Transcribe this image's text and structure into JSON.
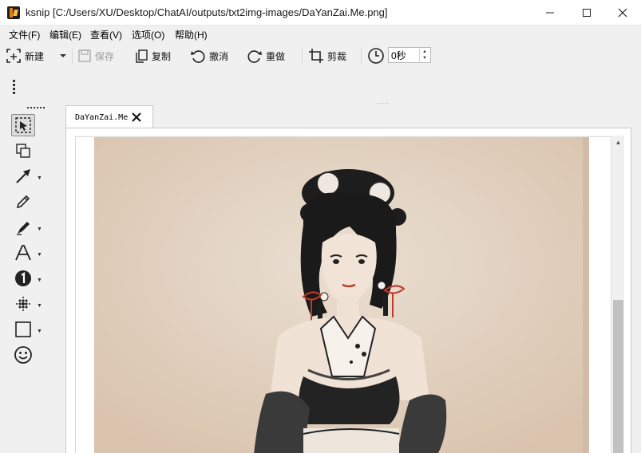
{
  "window": {
    "title": "ksnip [C:/Users/XU/Desktop/ChatAI/outputs/txt2img-images/DaYanZai.Me.png]",
    "minimize": "—",
    "maximize": "☐",
    "close": "✕"
  },
  "menu": [
    "文件(F)",
    "编辑(E)",
    "查看(V)",
    "选项(O)",
    "帮助(H)"
  ],
  "toolbar": {
    "new_label": "新建",
    "save_label": "保存",
    "copy_label": "复制",
    "undo_label": "撤消",
    "redo_label": "重做",
    "crop_label": "剪裁",
    "delay_value": "0秒"
  },
  "tab": {
    "label": "DaYanZai.Me"
  },
  "icons": {
    "app": "ksnip-app-icon",
    "tools": [
      "select-icon",
      "duplicate-icon",
      "arrow-icon",
      "pen-icon",
      "marker-icon",
      "text-icon",
      "number-icon",
      "blur-icon",
      "rectangle-icon",
      "sticker-icon"
    ]
  },
  "colors": {
    "window_bg": "#f0f0f0",
    "painting_bg": "#e7dacb",
    "ink": "#1a1a1a",
    "accent_red": "#c0392b"
  }
}
